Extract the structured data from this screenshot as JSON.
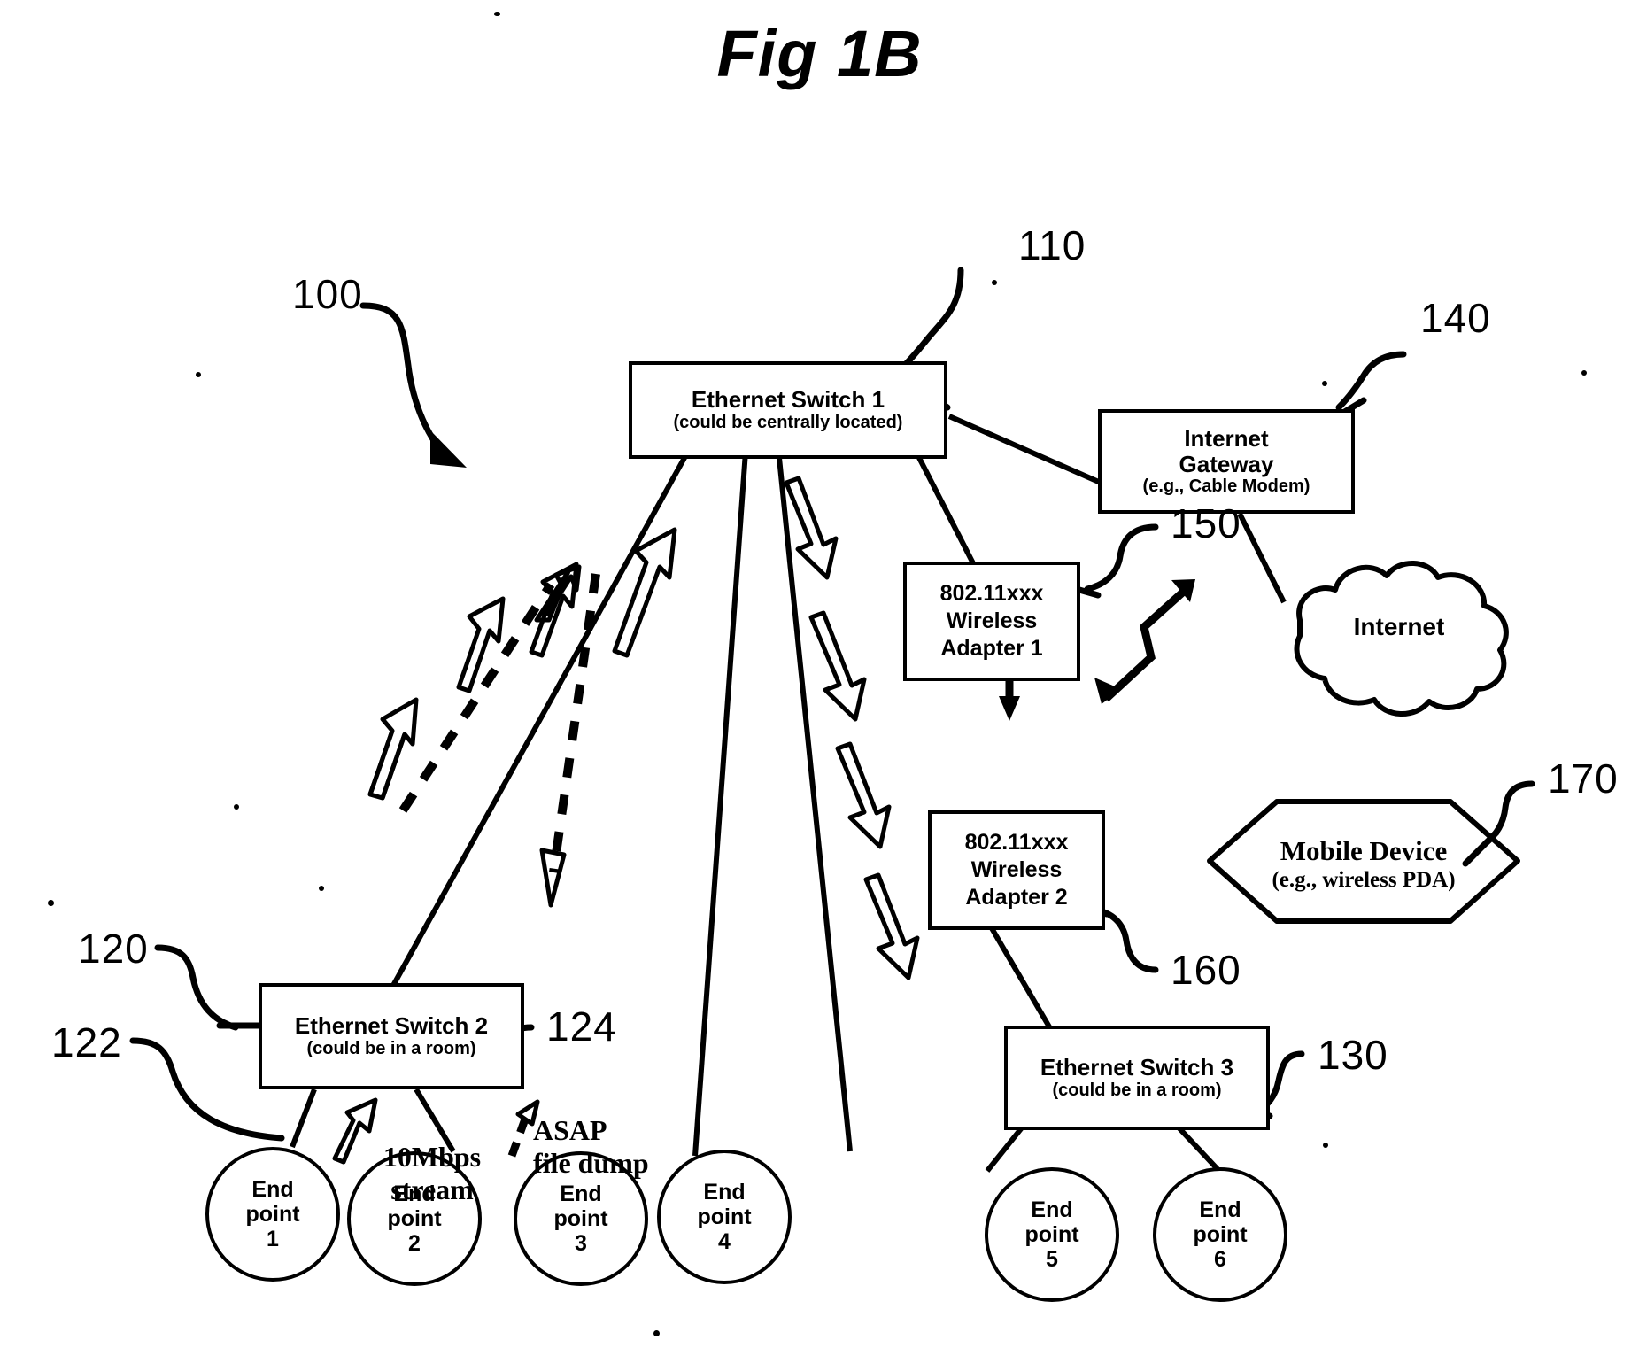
{
  "figure": {
    "title": "Fig 1B"
  },
  "reference_numerals": [
    {
      "id": "ref-100",
      "label": "100"
    },
    {
      "id": "ref-110",
      "label": "110"
    },
    {
      "id": "ref-120",
      "label": "120"
    },
    {
      "id": "ref-122",
      "label": "122"
    },
    {
      "id": "ref-124",
      "label": "124"
    },
    {
      "id": "ref-130",
      "label": "130"
    },
    {
      "id": "ref-140",
      "label": "140"
    },
    {
      "id": "ref-150",
      "label": "150"
    },
    {
      "id": "ref-160",
      "label": "160"
    },
    {
      "id": "ref-170",
      "label": "170"
    }
  ],
  "nodes": {
    "switch1": {
      "line1": "Ethernet Switch 1",
      "line2": "(could be centrally located)"
    },
    "switch2": {
      "line1": "Ethernet Switch 2",
      "line2": "(could be in a room)"
    },
    "switch3": {
      "line1": "Ethernet Switch 3",
      "line2": "(could be in a room)"
    },
    "gateway": {
      "line1": "Internet",
      "line2": "Gateway",
      "line3": "(e.g., Cable Modem)"
    },
    "adapter1": {
      "line1": "802.11xxx",
      "line2": "Wireless",
      "line3": "Adapter 1"
    },
    "adapter2": {
      "line1": "802.11xxx",
      "line2": "Wireless",
      "line3": "Adapter 2"
    },
    "internet_cloud": {
      "label": "Internet"
    },
    "mobile_device": {
      "line1": "Mobile Device",
      "line2": "(e.g., wireless PDA)"
    }
  },
  "endpoints": [
    {
      "line1": "End",
      "line2": "point",
      "line3": "1"
    },
    {
      "line1": "End",
      "line2": "point",
      "line3": "2"
    },
    {
      "line1": "End",
      "line2": "point",
      "line3": "3"
    },
    {
      "line1": "End",
      "line2": "point",
      "line3": "4"
    },
    {
      "line1": "End",
      "line2": "point",
      "line3": "5"
    },
    {
      "line1": "End",
      "line2": "point",
      "line3": "6"
    }
  ],
  "traffic_labels": {
    "stream": {
      "line1": "10Mbps",
      "line2": "stream"
    },
    "filedump": {
      "line1": "ASAP",
      "line2": "file dump"
    }
  },
  "colors": {
    "ink": "#000000",
    "paper": "#ffffff"
  }
}
